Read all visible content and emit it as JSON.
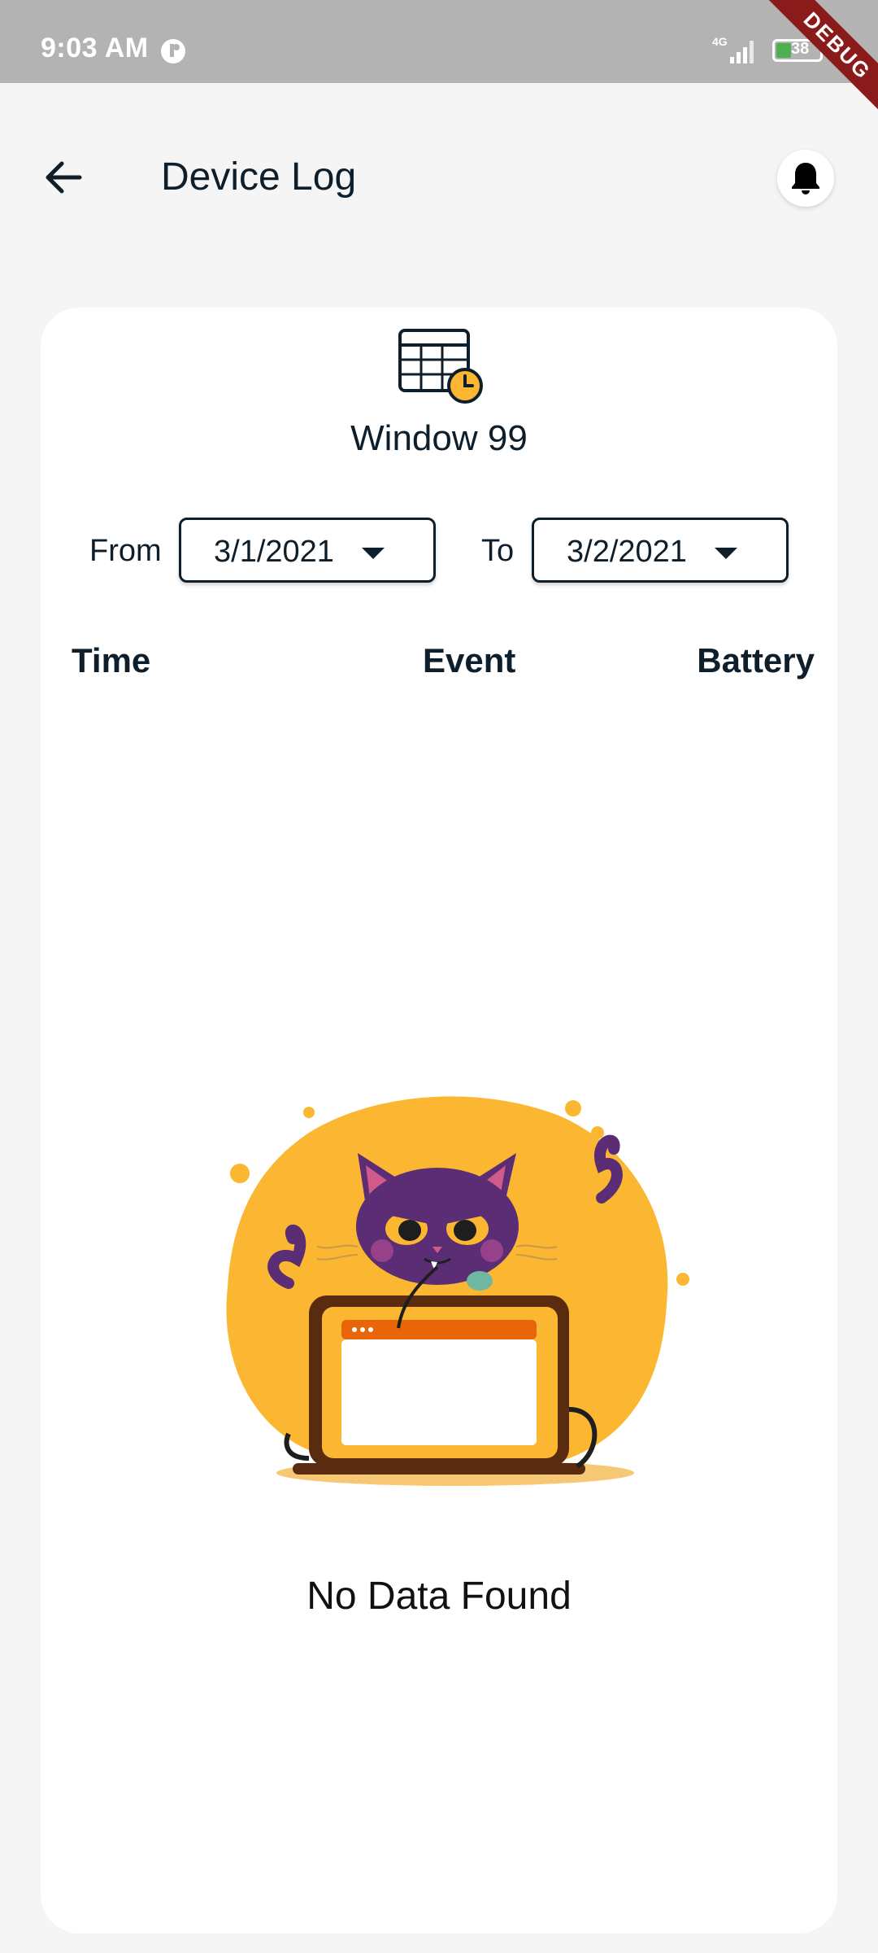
{
  "status_bar": {
    "time": "9:03 AM",
    "network": "4G",
    "battery": "38",
    "debug_banner": "DEBUG"
  },
  "app_bar": {
    "title": "Device Log",
    "back_icon": "arrow-left-icon",
    "notification_icon": "bell-icon"
  },
  "card": {
    "icon": "table-clock-icon",
    "device_name": "Window 99",
    "filter": {
      "from_label": "From",
      "from_value": "3/1/2021",
      "to_label": "To",
      "to_value": "3/2/2021"
    },
    "columns": [
      "Time",
      "Event",
      "Battery"
    ],
    "empty_state": {
      "illustration": "grumpy-cat-laptop-illustration",
      "message": "No Data Found"
    }
  },
  "colors": {
    "background": "#f5f5f5",
    "card": "#ffffff",
    "text": "#0e1f2b",
    "accent_yellow": "#fbb731",
    "cat_purple": "#5b2d74",
    "status_bar": "#b3b3b3",
    "debug_ribbon": "#8b1a1a"
  }
}
